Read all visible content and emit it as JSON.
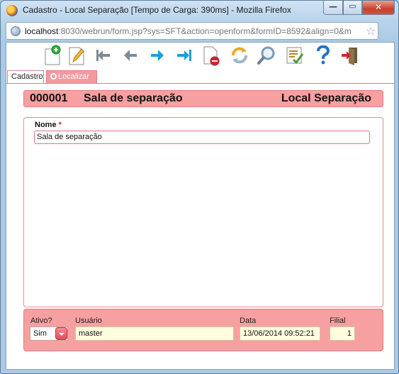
{
  "window": {
    "title": "Cadastro - Local Separação [Tempo de Carga: 390ms] - Mozilla Firefox",
    "minimize_glyph": "—",
    "maximize_glyph": "▭",
    "close_glyph": "✕"
  },
  "address_bar": {
    "host": "localhost",
    "path": ":8030/webrun/form.jsp?sys=SFT&action=openform&formID=8592&align=0&m"
  },
  "toolbar": {
    "buttons": [
      {
        "icon": "new-record-icon",
        "color": "#2fae3a"
      },
      {
        "icon": "edit-pencil-icon",
        "color": "#f2b93b"
      },
      {
        "icon": "first-record-icon",
        "color": "#7f8a96"
      },
      {
        "icon": "previous-record-icon",
        "color": "#7f8a96"
      },
      {
        "icon": "next-record-icon",
        "color": "#1e9fd8"
      },
      {
        "icon": "last-record-icon",
        "color": "#1e9fd8"
      },
      {
        "icon": "delete-record-icon",
        "color": "#d4242b"
      },
      {
        "icon": "refresh-icon",
        "color": "#f0a82a"
      },
      {
        "icon": "search-icon",
        "color": "#7e9bb8"
      },
      {
        "icon": "checklist-icon",
        "color": "#4a9a3c"
      },
      {
        "icon": "help-icon",
        "color": "#1e74c9"
      },
      {
        "icon": "exit-icon",
        "color": "#d4242b"
      }
    ]
  },
  "tabs": [
    {
      "label": "Cadastro",
      "active": true
    },
    {
      "label": "Localizar",
      "active": false
    }
  ],
  "header": {
    "code": "000001",
    "name": "Sala de separação",
    "form_title": "Local Separação"
  },
  "form": {
    "nome_label": "Nome",
    "required_mark": "*",
    "nome_value": "Sala de separação"
  },
  "footer": {
    "ativo_label": "Ativo?",
    "ativo_value": "Sim",
    "usuario_label": "Usuário",
    "usuario_value": "master",
    "data_label": "Data",
    "data_value": "13/06/2014 09:52:21",
    "filial_label": "Filial",
    "filial_value": "1"
  },
  "colors": {
    "accent": "#f7a0a1",
    "accent_border": "#e07e80",
    "field_bg": "#fffde0"
  }
}
